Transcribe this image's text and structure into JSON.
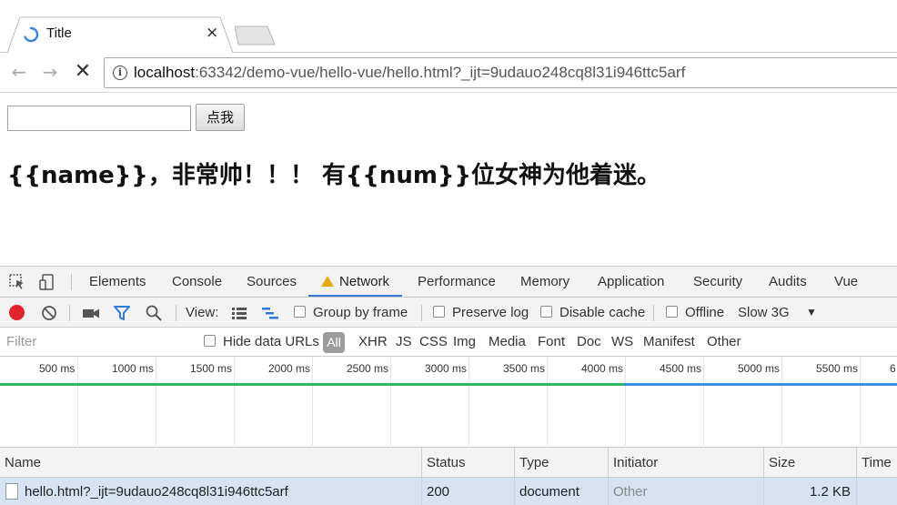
{
  "browser": {
    "tab_title": "Title",
    "tab_close": "×",
    "url_host": "localhost",
    "url_rest": ":63342/demo-vue/hello-vue/hello.html?_ijt=9udauo248cq8l31i946ttc5arf",
    "nav": {
      "back": "←",
      "forward": "→",
      "stop": "✕"
    },
    "info_icon_glyph": "i"
  },
  "page": {
    "button_label": "点我",
    "input_value": "",
    "heading": "{{name}}，非常帅！！！ 有{{num}}位女神为他着迷。"
  },
  "devtools": {
    "tabs": [
      "Elements",
      "Console",
      "Sources",
      "Network",
      "Performance",
      "Memory",
      "Application",
      "Security",
      "Audits",
      "Vue"
    ],
    "active_tab": "Network",
    "toolbar": {
      "view_label": "View:",
      "group_by_frame": "Group by frame",
      "preserve_log": "Preserve log",
      "disable_cache": "Disable cache",
      "offline": "Offline",
      "throttle": "Slow 3G",
      "dropdown_arrow": "▼"
    },
    "filter": {
      "placeholder": "Filter",
      "hide_data_urls": "Hide data URLs",
      "types": [
        "All",
        "XHR",
        "JS",
        "CSS",
        "Img",
        "Media",
        "Font",
        "Doc",
        "WS",
        "Manifest",
        "Other"
      ]
    },
    "timeline_ticks": [
      "500 ms",
      "1000 ms",
      "1500 ms",
      "2000 ms",
      "2500 ms",
      "3000 ms",
      "3500 ms",
      "4000 ms",
      "4500 ms",
      "5000 ms",
      "5500 ms",
      "6"
    ],
    "columns": [
      "Name",
      "Status",
      "Type",
      "Initiator",
      "Size",
      "Time"
    ],
    "rows": [
      {
        "name": "hello.html?_ijt=9udauo248cq8l31i946ttc5arf",
        "status": "200",
        "type": "document",
        "initiator": "Other",
        "size": "1.2 KB",
        "time": ""
      }
    ],
    "colors": {
      "record": "#e0242c",
      "accent": "#3879d9",
      "warning": "#e6a817",
      "load_line": "#2fb460",
      "dom_line": "#3d8fe0"
    }
  }
}
